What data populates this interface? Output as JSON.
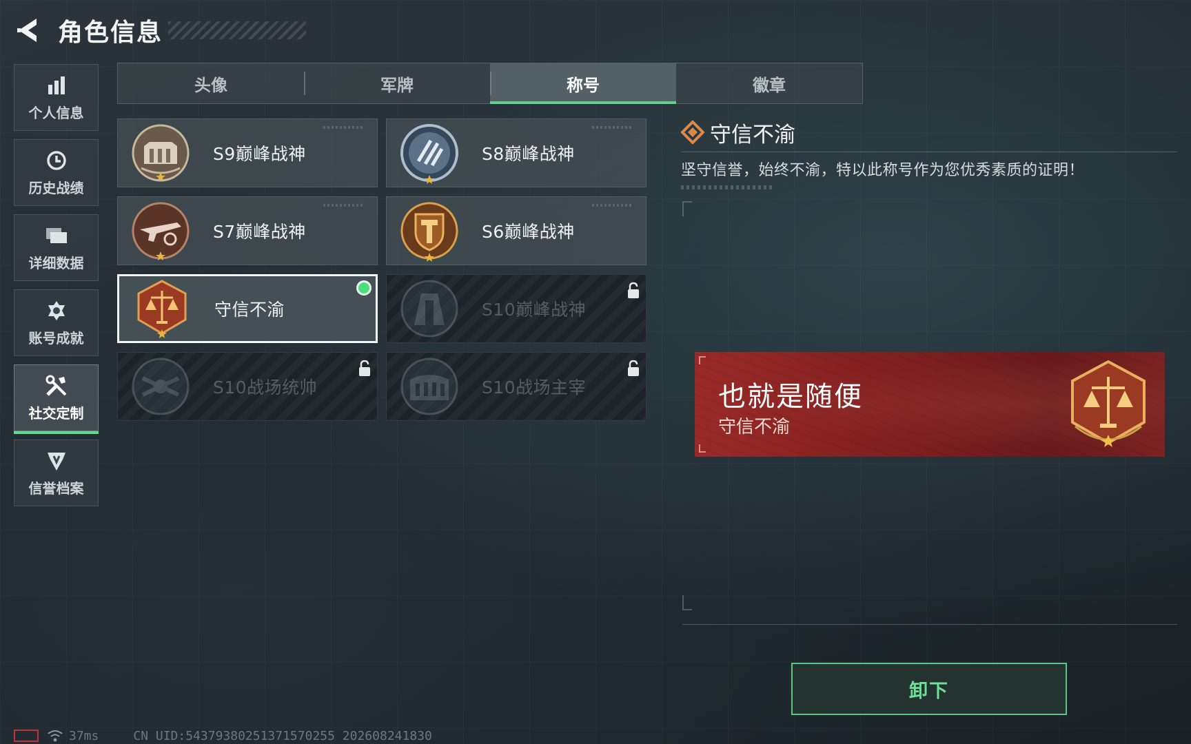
{
  "header": {
    "title": "角色信息"
  },
  "sidebar": {
    "items": [
      {
        "label": "个人信息",
        "icon": "bar-chart-icon"
      },
      {
        "label": "历史战绩",
        "icon": "history-clock-icon"
      },
      {
        "label": "详细数据",
        "icon": "folder-icon"
      },
      {
        "label": "账号成就",
        "icon": "achievement-icon"
      },
      {
        "label": "社交定制",
        "icon": "tools-icon",
        "active": true
      },
      {
        "label": "信誉档案",
        "icon": "credit-shield-icon"
      }
    ]
  },
  "tabs": [
    {
      "label": "头像"
    },
    {
      "label": "军牌"
    },
    {
      "label": "称号",
      "active": true
    },
    {
      "label": "徽章"
    }
  ],
  "titles": [
    {
      "label": "S9巅峰战神",
      "state": "unlocked",
      "emblem": "fortress-emblem"
    },
    {
      "label": "S8巅峰战神",
      "state": "unlocked",
      "emblem": "blade-emblem"
    },
    {
      "label": "S7巅峰战神",
      "state": "unlocked",
      "emblem": "gun-emblem"
    },
    {
      "label": "S6巅峰战神",
      "state": "unlocked",
      "emblem": "shield-t-emblem"
    },
    {
      "label": "守信不渝",
      "state": "equipped",
      "emblem": "scales-emblem"
    },
    {
      "label": "S10巅峰战神",
      "state": "locked",
      "emblem": "tower-emblem"
    },
    {
      "label": "S10战场统帅",
      "state": "locked",
      "emblem": "drone-emblem"
    },
    {
      "label": "S10战场主宰",
      "state": "locked",
      "emblem": "colosseum-emblem"
    }
  ],
  "detail": {
    "title": "守信不渝",
    "description": "坚守信誉，始终不渝，特以此称号作为您优秀素质的证明！"
  },
  "nameplate": {
    "player_name": "也就是随便",
    "title": "守信不渝"
  },
  "actions": {
    "unequip_label": "卸下"
  },
  "footer": {
    "ping": "37ms",
    "uid": "CN UID:5437938025137157025​5 202608241830"
  },
  "colors": {
    "accent_green": "#5fd38c",
    "nameplate_red": "#8a2524",
    "emblem_bronze": "#b9743f"
  }
}
